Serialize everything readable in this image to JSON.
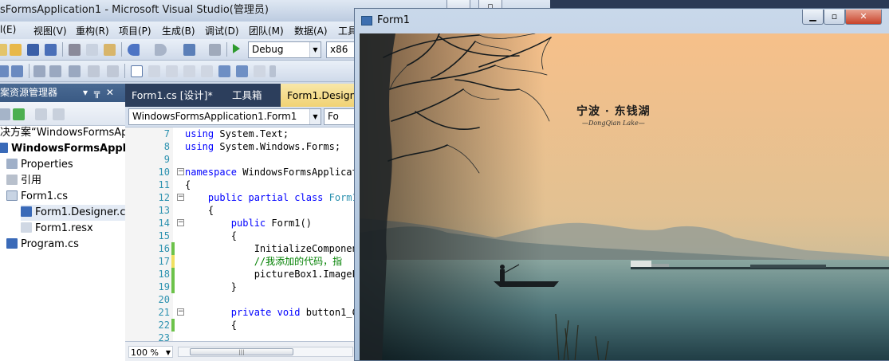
{
  "vs": {
    "title": "sFormsApplication1 - Microsoft Visual Studio(管理员)",
    "menu": [
      "l(E)",
      "视图(V)",
      "重构(R)",
      "项目(P)",
      "生成(B)",
      "调试(D)",
      "团队(M)",
      "数据(A)",
      "工具"
    ],
    "toolbar": {
      "config": "Debug",
      "platform": "x86"
    },
    "solution_explorer": {
      "title": "案资源管理器",
      "pin": "▾ ╦ ✕",
      "items": [
        {
          "label": "决方案“WindowsFormsAp",
          "bold": false
        },
        {
          "label": "WindowsFormsApplicat",
          "bold": true
        },
        {
          "label": "Properties",
          "bold": false
        },
        {
          "label": "引用",
          "bold": false
        },
        {
          "label": "Form1.cs",
          "bold": false
        },
        {
          "label": "Form1.Designer.cs",
          "bold": false
        },
        {
          "label": "Form1.resx",
          "bold": false
        },
        {
          "label": "Program.cs",
          "bold": false
        }
      ]
    },
    "editor": {
      "tabs": [
        "Form1.cs [设计]*",
        "工具箱",
        "Form1.Designe"
      ],
      "nav_class": "WindowsFormsApplication1.Form1",
      "nav_member": "Fo",
      "line_numbers": [
        "7",
        "8",
        "9",
        "10",
        "11",
        "12",
        "13",
        "14",
        "15",
        "16",
        "17",
        "18",
        "19",
        "20",
        "21",
        "22",
        "23"
      ],
      "zoom": "100 %"
    }
  },
  "form1": {
    "title": "Form1",
    "controls": {
      "minimize": "▁",
      "maximize": "▫",
      "close": "✕"
    },
    "photo": {
      "caption": "宁波 · 东钱湖",
      "subcaption": "—DongQian Lake—"
    }
  },
  "colors": {
    "keyword": "#0000ff",
    "type": "#2b91af",
    "comment": "#008000",
    "change_saved": "#6cc24a",
    "change_unsaved": "#f0e060"
  }
}
